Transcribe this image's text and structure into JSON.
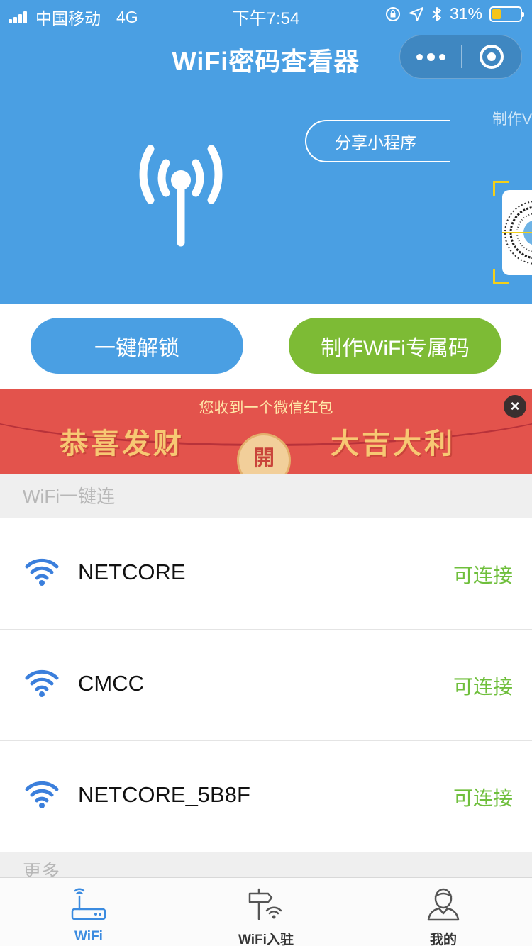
{
  "status_bar": {
    "carrier": "中国移动",
    "network": "4G",
    "time": "下午7:54",
    "battery": "31%",
    "battery_level": 0.31
  },
  "nav": {
    "title": "WiFi密码查看器"
  },
  "hero": {
    "share_button": "分享小程序",
    "side_label": "制作V"
  },
  "actions": {
    "unlock_label": "一键解锁",
    "make_code_label": "制作WiFi专属码"
  },
  "banner": {
    "title": "您收到一个微信红包",
    "left_text": "恭喜发财",
    "right_text": "大吉大利",
    "open_label": "開"
  },
  "sections": {
    "connect_title": "WiFi一键连",
    "more_title": "更多"
  },
  "wifi_list": [
    {
      "ssid": "NETCORE",
      "status": "可连接"
    },
    {
      "ssid": "CMCC",
      "status": "可连接"
    },
    {
      "ssid": "NETCORE_5B8F",
      "status": "可连接"
    }
  ],
  "tabbar": {
    "items": [
      {
        "label": "WiFi",
        "icon": "router-icon"
      },
      {
        "label": "WiFi入驻",
        "icon": "signpost-wifi-icon"
      },
      {
        "label": "我的",
        "icon": "person-icon"
      }
    ]
  },
  "colors": {
    "primary_blue": "#4a9fe3",
    "accent_green": "#7dbb35",
    "status_green": "#6fbf3c",
    "banner_red": "#e3534c"
  }
}
